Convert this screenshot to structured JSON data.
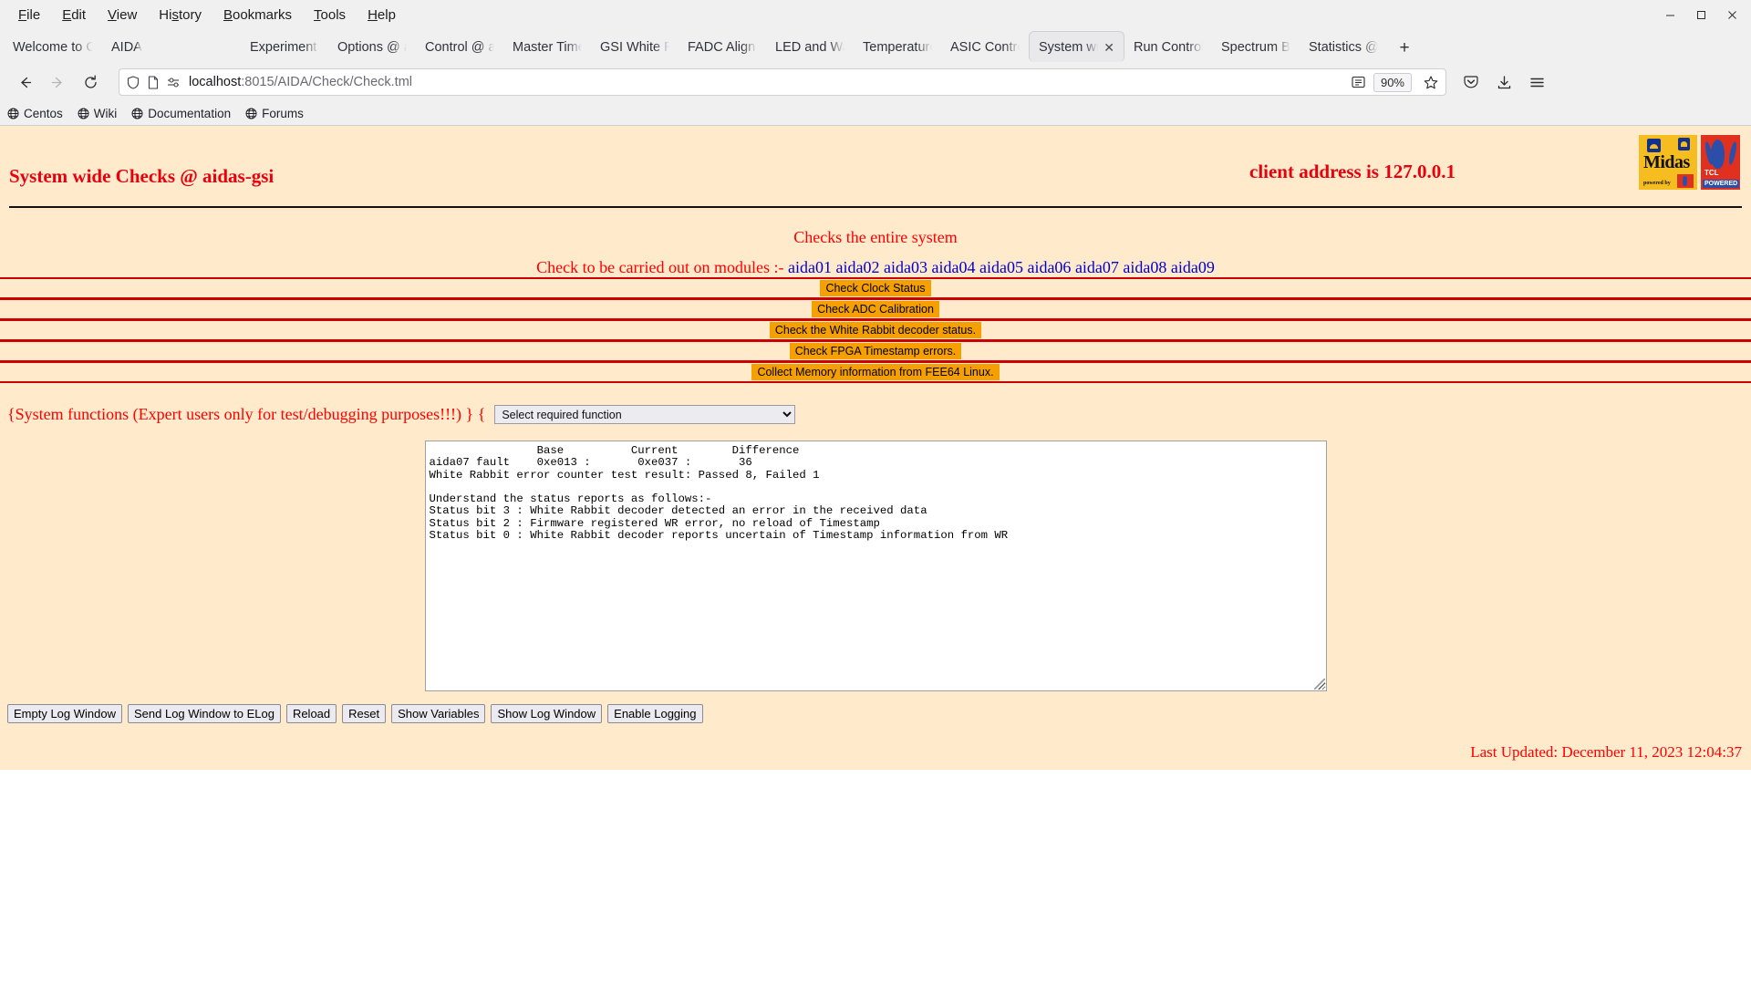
{
  "browser": {
    "menus": [
      {
        "label": "File",
        "accel": "F"
      },
      {
        "label": "Edit",
        "accel": "E"
      },
      {
        "label": "View",
        "accel": "V"
      },
      {
        "label": "History",
        "accel": "s"
      },
      {
        "label": "Bookmarks",
        "accel": "B"
      },
      {
        "label": "Tools",
        "accel": "T"
      },
      {
        "label": "Help",
        "accel": "H"
      }
    ],
    "window_controls": {
      "minimize": "—",
      "maximize": "❐",
      "close": "✕"
    },
    "tabs": [
      {
        "label": "Welcome to Cen",
        "active": false
      },
      {
        "label": "AIDA",
        "active": false
      },
      {
        "label": "Experiment Con",
        "active": false
      },
      {
        "label": "Options @ aidas",
        "active": false
      },
      {
        "label": "Control @ aidas",
        "active": false
      },
      {
        "label": "Master Timestam",
        "active": false
      },
      {
        "label": "GSI White Rabbi",
        "active": false
      },
      {
        "label": "FADC Align & Co",
        "active": false
      },
      {
        "label": "LED and Wavefo",
        "active": false
      },
      {
        "label": "Temperature and",
        "active": false
      },
      {
        "label": "ASIC Control @",
        "active": false
      },
      {
        "label": "System wide C",
        "active": true
      },
      {
        "label": "Run Control @ a",
        "active": false
      },
      {
        "label": "Spectrum Brows",
        "active": false
      },
      {
        "label": "Statistics @ aida",
        "active": false
      }
    ],
    "new_tab_label": "+",
    "nav": {
      "back": "←",
      "forward": "→",
      "reload": "↻"
    },
    "url": {
      "host": "localhost",
      "path": ":8015/AIDA/Check/Check.tml",
      "full": "localhost:8015/AIDA/Check/Check.tml"
    },
    "zoom_level": "90%",
    "bookmarks": [
      {
        "label": "Centos"
      },
      {
        "label": "Wiki"
      },
      {
        "label": "Documentation"
      },
      {
        "label": "Forums"
      }
    ]
  },
  "page": {
    "title": "System wide Checks @ aidas-gsi",
    "client_address": "client address is 127.0.0.1",
    "logo_midas": {
      "word": "Midas",
      "sub": "powered by",
      "tcl_tag": "TCL"
    },
    "logo_tcl": {
      "top": "TCL",
      "bottom": "POWERED"
    },
    "subtitle": "Checks the entire system",
    "modules_prefix": "Check to be carried out on modules :-",
    "modules": [
      "aida01",
      "aida02",
      "aida03",
      "aida04",
      "aida05",
      "aida06",
      "aida07",
      "aida08",
      "aida09"
    ],
    "check_buttons": [
      {
        "label": "Check Clock Status"
      },
      {
        "label": "Check ADC Calibration"
      },
      {
        "label": "Check the White Rabbit decoder status."
      },
      {
        "label": "Check FPGA Timestamp errors."
      },
      {
        "label": "Collect Memory information from FEE64 Linux."
      }
    ],
    "sysfunc_label": "{System functions (Expert users only for test/debugging purposes!!!)  } {",
    "sysfunc_select": {
      "value": "Select required function",
      "options": [
        "Select required function"
      ]
    },
    "log_text": "                Base          Current        Difference\naida07 fault    0xe013 :       0xe037 :       36\nWhite Rabbit error counter test result: Passed 8, Failed 1\n\nUnderstand the status reports as follows:-\nStatus bit 3 : White Rabbit decoder detected an error in the received data\nStatus bit 2 : Firmware registered WR error, no reload of Timestamp\nStatus bit 0 : White Rabbit decoder reports uncertain of Timestamp information from WR",
    "action_buttons": [
      {
        "label": "Empty Log Window"
      },
      {
        "label": "Send Log Window to ELog"
      },
      {
        "label": "Reload"
      },
      {
        "label": "Reset"
      },
      {
        "label": "Show Variables"
      },
      {
        "label": "Show Log Window"
      },
      {
        "label": "Enable Logging"
      }
    ],
    "last_updated": "Last Updated: December 11, 2023 12:04:37"
  },
  "colors": {
    "page_bg": "#ffeacc",
    "heading_red": "#e8000d",
    "text_red": "#ff0000",
    "rule_red": "#cc0000",
    "button_orange": "#f5a000",
    "link_blue": "#0000cc"
  }
}
